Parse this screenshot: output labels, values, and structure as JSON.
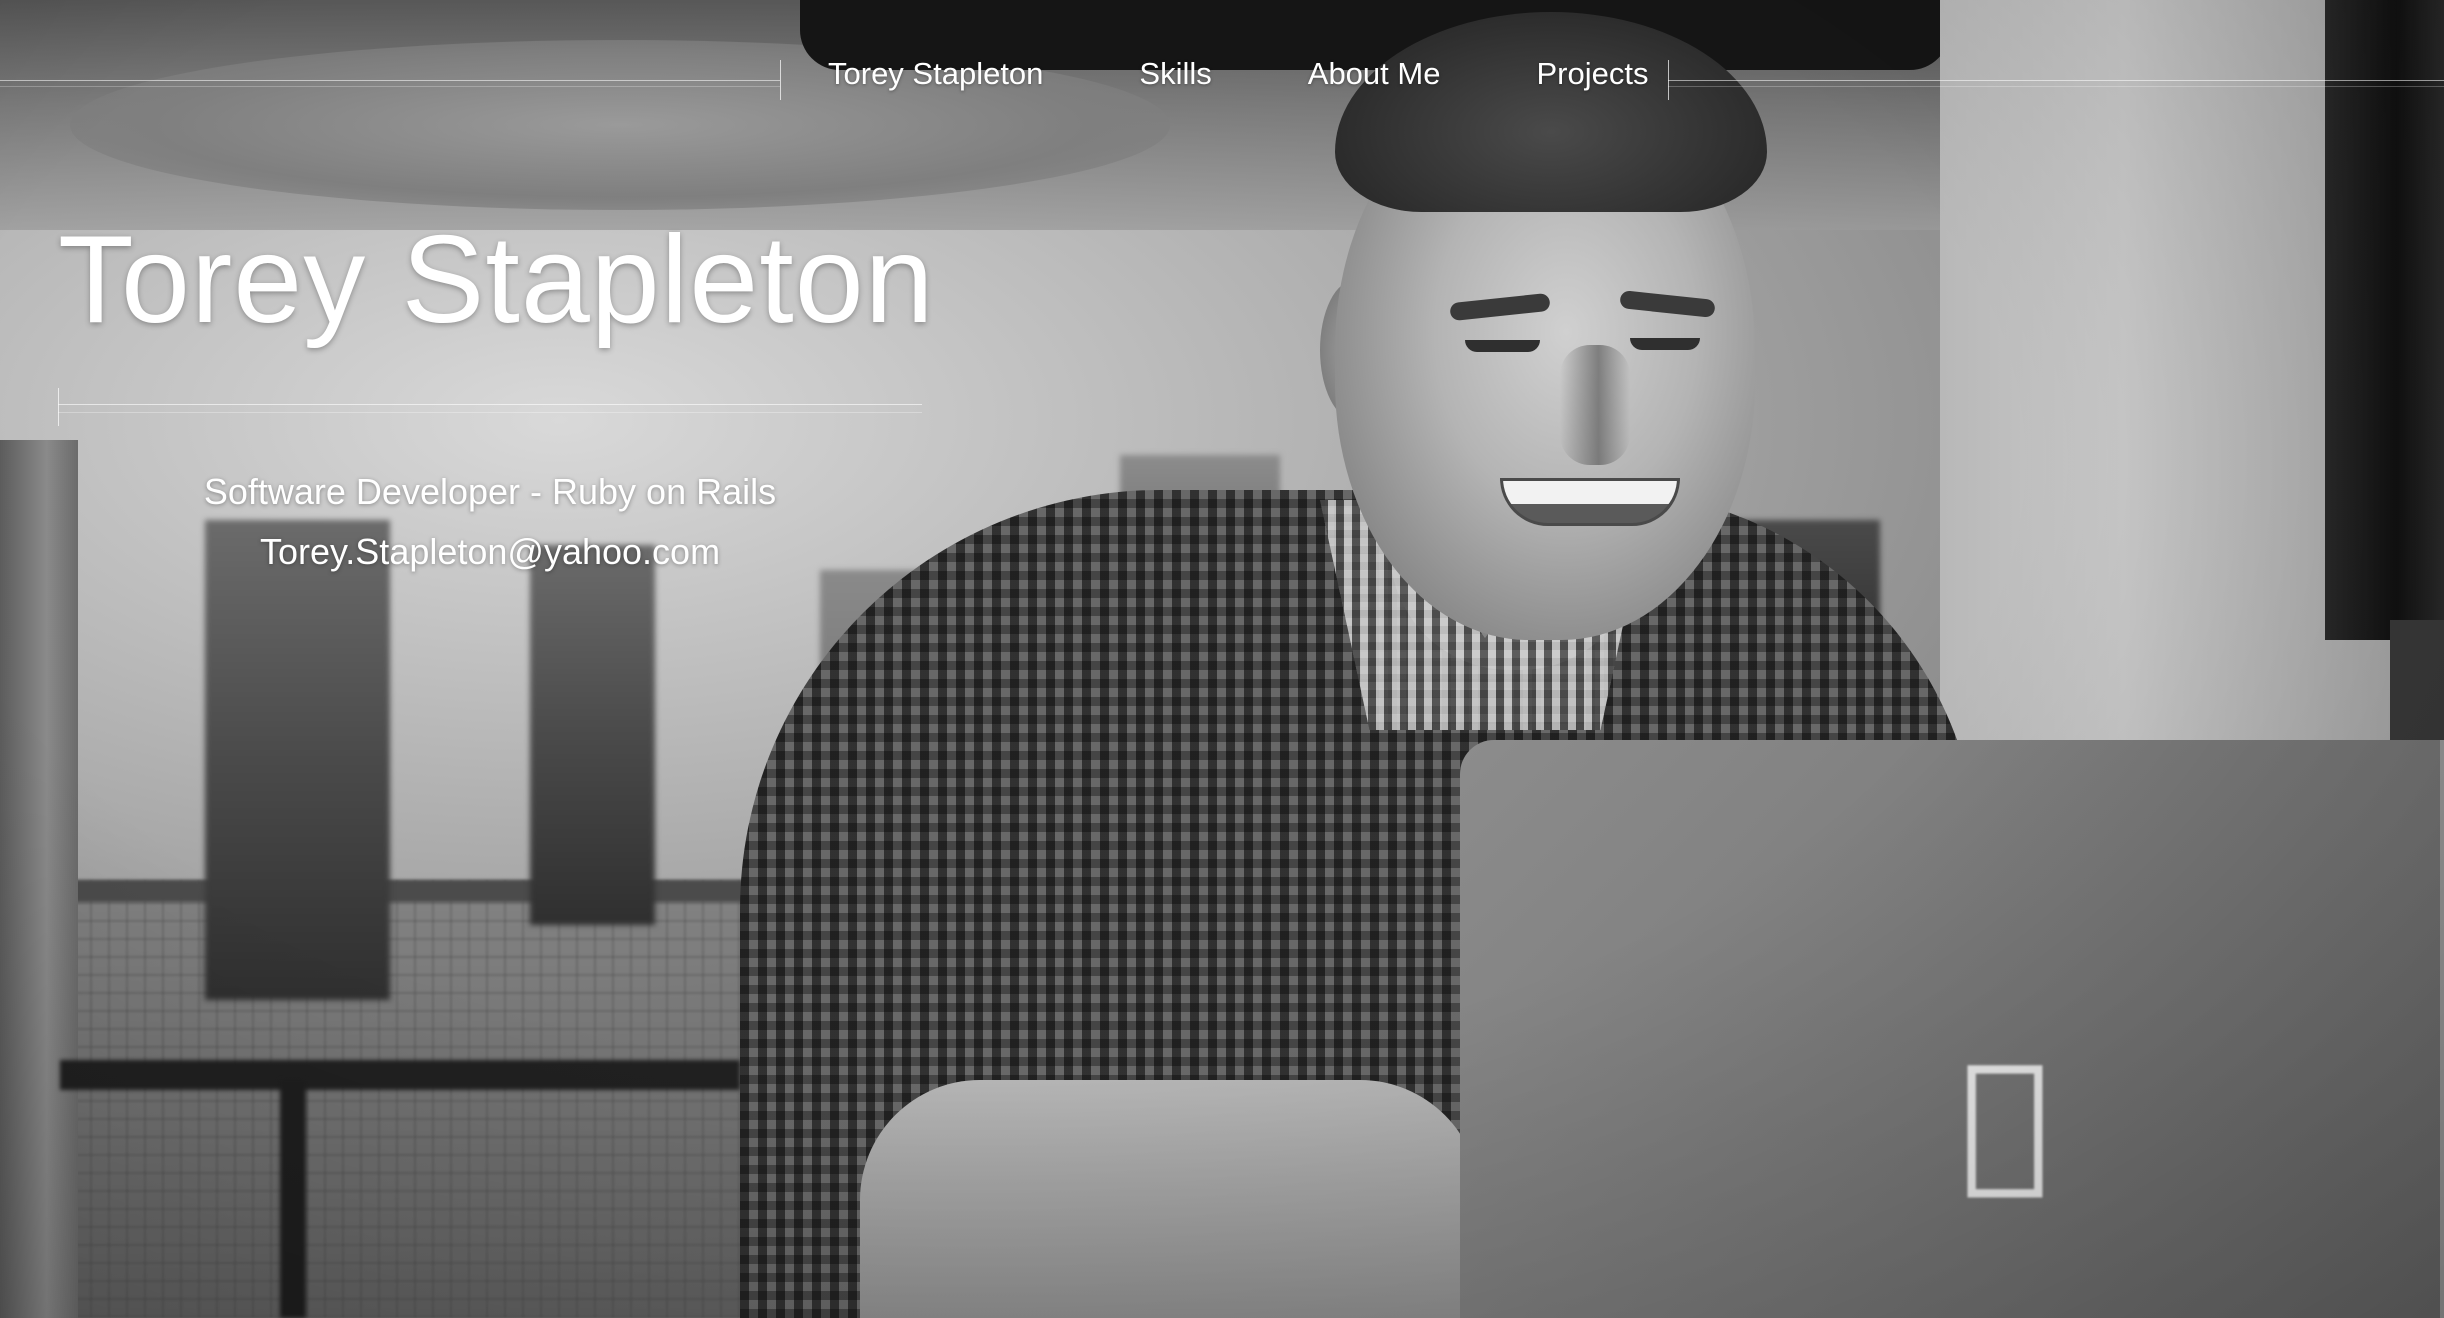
{
  "nav": {
    "items": [
      {
        "label": "Torey Stapleton"
      },
      {
        "label": "Skills"
      },
      {
        "label": "About Me"
      },
      {
        "label": "Projects"
      }
    ]
  },
  "hero": {
    "title": "Torey Stapleton",
    "subtitle": "Software Developer - Ruby on Rails",
    "email": "Torey.Stapleton@yahoo.com",
    "background_image": "black-and-white-photo-of-man-smiling-at-laptop"
  },
  "icons": {
    "laptop_logo": "apple-logo-icon"
  },
  "colors": {
    "text": "#ffffff",
    "rule": "#ffffff"
  }
}
